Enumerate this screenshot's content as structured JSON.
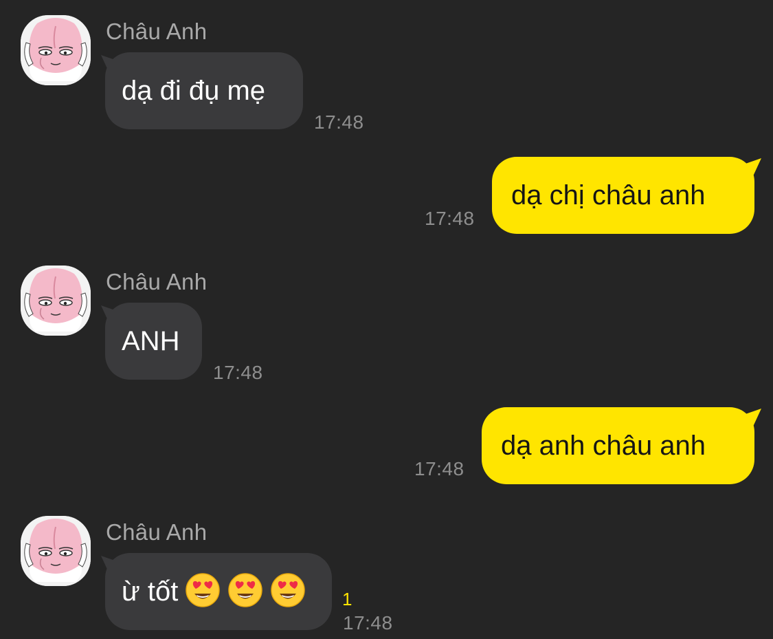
{
  "messages": [
    {
      "sender": "Châu Anh",
      "text": "dạ đi đụ mẹ",
      "time": "17:48"
    },
    {
      "text": "dạ chị châu anh",
      "time": "17:48"
    },
    {
      "sender": "Châu Anh",
      "text": "ANH",
      "time": "17:48"
    },
    {
      "text": "dạ anh châu anh",
      "time": "17:48"
    },
    {
      "sender": "Châu Anh",
      "text": "ừ tốt",
      "emoji": [
        "heart-eyes-emoji",
        "heart-eyes-emoji",
        "heart-eyes-emoji"
      ],
      "unread": "1",
      "time": "17:48"
    }
  ],
  "colors": {
    "background": "#252525",
    "incoming_bubble": "#3a3a3c",
    "outgoing_bubble": "#ffe500",
    "timestamp": "#8e8e8e",
    "sender_name": "#a9a9a9",
    "unread_count": "#ffe500"
  }
}
